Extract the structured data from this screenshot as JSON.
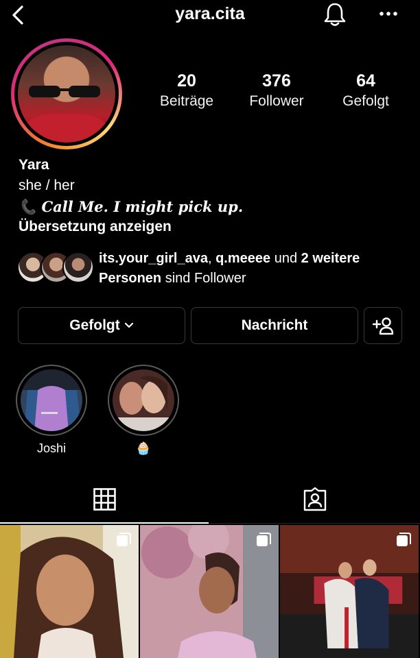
{
  "header": {
    "username": "yara.cita"
  },
  "profile": {
    "stats": [
      {
        "value": "20",
        "label": "Beiträge"
      },
      {
        "value": "376",
        "label": "Follower"
      },
      {
        "value": "64",
        "label": "Gefolgt"
      }
    ],
    "name": "Yara",
    "pronouns": "she / her",
    "bio_line": "📞 Call Me. I might pick up.",
    "translate_label": "Übersetzung anzeigen"
  },
  "mutual_followers": {
    "user1": "its.your_girl_ava",
    "sep1": ", ",
    "user2": "q.meeee",
    "and": " und ",
    "more": "2 weitere Personen",
    "suffix": " sind Follower"
  },
  "actions": {
    "following_label": "Gefolgt",
    "message_label": "Nachricht"
  },
  "highlights": [
    {
      "label": "Joshi"
    },
    {
      "label": "🧁"
    }
  ],
  "icons": {
    "back": "chevron-left-icon",
    "bell": "bell-icon",
    "more": "more-horizontal-icon",
    "add_person": "add-person-icon",
    "grid": "grid-icon",
    "tagged": "tagged-person-icon",
    "multi": "multiple-posts-icon"
  },
  "colors": {
    "background": "#000000",
    "border": "#3a3a3a",
    "text": "#ffffff"
  }
}
